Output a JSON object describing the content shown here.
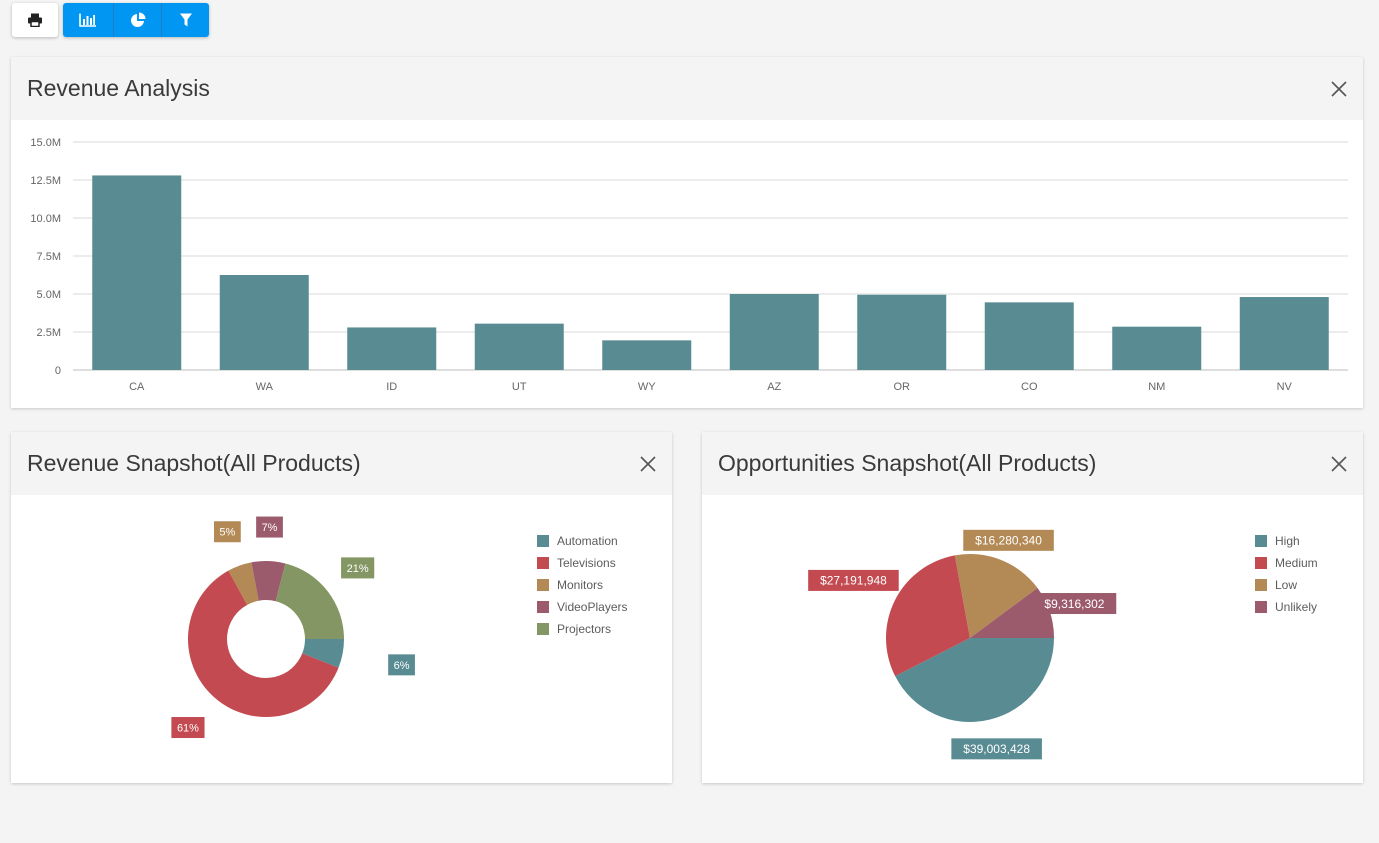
{
  "toolbar": {
    "buttons": [
      {
        "name": "print-button",
        "icon": "print-icon"
      },
      {
        "name": "bar-chart-button",
        "icon": "bar-chart-icon"
      },
      {
        "name": "pie-chart-button",
        "icon": "pie-chart-icon"
      },
      {
        "name": "filter-button",
        "icon": "filter-icon"
      }
    ]
  },
  "colors": {
    "accent": "#0096f2",
    "teal": "#598b93",
    "red": "#c34a50",
    "gold": "#b38955",
    "plum": "#9b5b6d",
    "olive": "#839663"
  },
  "panels": {
    "revenue_analysis": {
      "title": "Revenue Analysis"
    },
    "revenue_snapshot": {
      "title": "Revenue Snapshot(All Products)"
    },
    "opportunities_snapshot": {
      "title": "Opportunities Snapshot(All Products)"
    }
  },
  "chart_data": [
    {
      "type": "bar",
      "categories": [
        "CA",
        "WA",
        "ID",
        "UT",
        "WY",
        "AZ",
        "OR",
        "CO",
        "NM",
        "NV"
      ],
      "values": [
        12800000,
        6250000,
        2800000,
        3050000,
        1950000,
        5000000,
        4950000,
        4450000,
        2850000,
        4800000
      ],
      "ylim": [
        0,
        15000000
      ],
      "yticks": [
        {
          "value": 0,
          "label": "0"
        },
        {
          "value": 2500000,
          "label": "2.5M"
        },
        {
          "value": 5000000,
          "label": "5.0M"
        },
        {
          "value": 7500000,
          "label": "7.5M"
        },
        {
          "value": 10000000,
          "label": "10.0M"
        },
        {
          "value": 12500000,
          "label": "12.5M"
        },
        {
          "value": 15000000,
          "label": "15.0M"
        }
      ],
      "grid": true,
      "color": "#598b93"
    },
    {
      "type": "pie",
      "donut": true,
      "slices": [
        {
          "name": "Automation",
          "value": 6,
          "label": "6%",
          "color": "#598b93"
        },
        {
          "name": "Televisions",
          "value": 61,
          "label": "61%",
          "color": "#c34a50"
        },
        {
          "name": "Monitors",
          "value": 5,
          "label": "5%",
          "color": "#b38955"
        },
        {
          "name": "VideoPlayers",
          "value": 7,
          "label": "7%",
          "color": "#9b5b6d"
        },
        {
          "name": "Projectors",
          "value": 21,
          "label": "21%",
          "color": "#839663"
        }
      ],
      "legend_position": "right"
    },
    {
      "type": "pie",
      "donut": false,
      "slices": [
        {
          "name": "High",
          "value": 39003428,
          "label": "$39,003,428",
          "color": "#598b93"
        },
        {
          "name": "Medium",
          "value": 27191948,
          "label": "$27,191,948",
          "color": "#c34a50"
        },
        {
          "name": "Low",
          "value": 16280340,
          "label": "$16,280,340",
          "color": "#b38955"
        },
        {
          "name": "Unlikely",
          "value": 9316302,
          "label": "$9,316,302",
          "color": "#9b5b6d"
        }
      ],
      "legend_position": "right"
    }
  ]
}
